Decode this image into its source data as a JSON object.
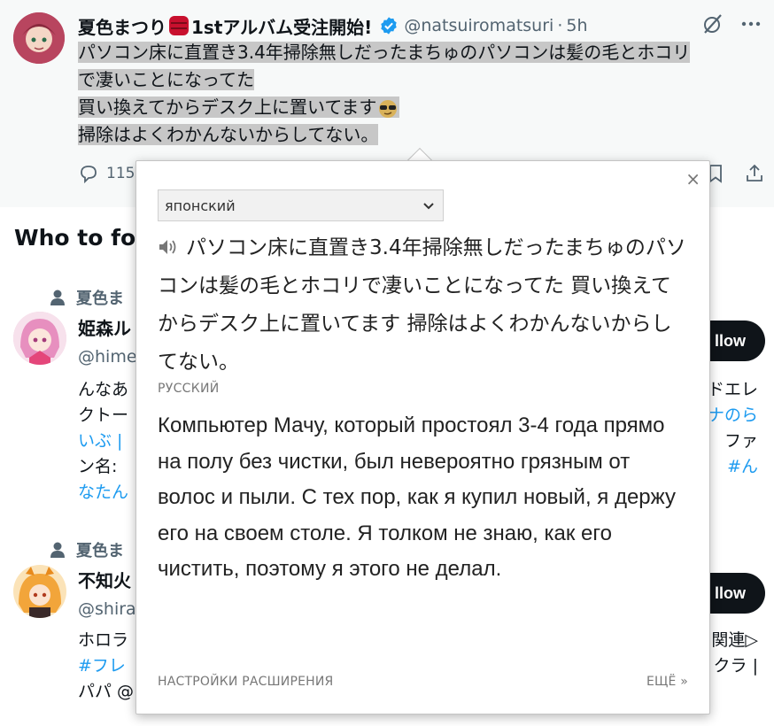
{
  "tweet": {
    "author_name": "夏色まつり",
    "author_name_suffix": "1stアルバム受注開始!",
    "handle": "@natsuiromatsuri",
    "separator": "·",
    "time": "5h",
    "text_lines": [
      "パソコン床に直置き3.4年掃除無しだったまちゅのパソコンは髪の毛とホコリ",
      "で凄いことになってた",
      "買い換えてからデスク上に置いてます",
      "掃除はよくわかんないからしてない。"
    ],
    "reply_count": "115"
  },
  "who_to_follow": {
    "title": "Who to fo",
    "suggestions": [
      {
        "followed_by": "夏色ま",
        "name": "姫森ル",
        "handle": "@hime",
        "button": "llow",
        "bio_left": [
          "んなあ",
          "クトー",
          "いぶ |",
          "ン名:",
          "なたん"
        ],
        "bio_right": [
          "ドエレ",
          "#ルーナのら",
          "ファ",
          "#ん"
        ]
      },
      {
        "followed_by": "夏色ま",
        "name": "不知火",
        "handle": "@shira",
        "button": "llow",
        "bio_left": [
          "ホロラ",
          "#フレ",
          "パパ @"
        ],
        "bio_right": [
          "関連▷",
          "クラ |"
        ]
      }
    ]
  },
  "translate_popup": {
    "close": "×",
    "source_language": "японский",
    "source_text": "パソコン床に直置き3.4年掃除無しだったまちゅのパソコンは髪の毛とホコリで凄いことになってた 買い換えてからデスク上に置いてます 掃除はよくわかんないからしてない。",
    "target_language_label": "РУССКИЙ",
    "translation": "Компьютер Мачу, который простоял 3-4 года прямо на полу без чистки, был невероятно грязным от волос и пыли. С тех пор, как я купил новый, я держу его на своем столе. Я толком не знаю, как его чистить, поэтому я этого не делал.",
    "settings_link": "НАСТРОЙКИ РАСШИРЕНИЯ",
    "more_link": "ЕЩЁ »"
  },
  "colors": {
    "accent_blue": "#1d9bf0",
    "text_primary": "#0f1419",
    "text_secondary": "#536471",
    "selection_highlight": "#c7c7c7",
    "follow_button": "#0f1419"
  },
  "icons": [
    "verified-badge-icon",
    "grok-slash-icon",
    "more-icon",
    "reply-icon",
    "bookmark-icon",
    "share-icon",
    "person-icon",
    "speaker-icon",
    "chevron-down-icon",
    "close-icon"
  ]
}
